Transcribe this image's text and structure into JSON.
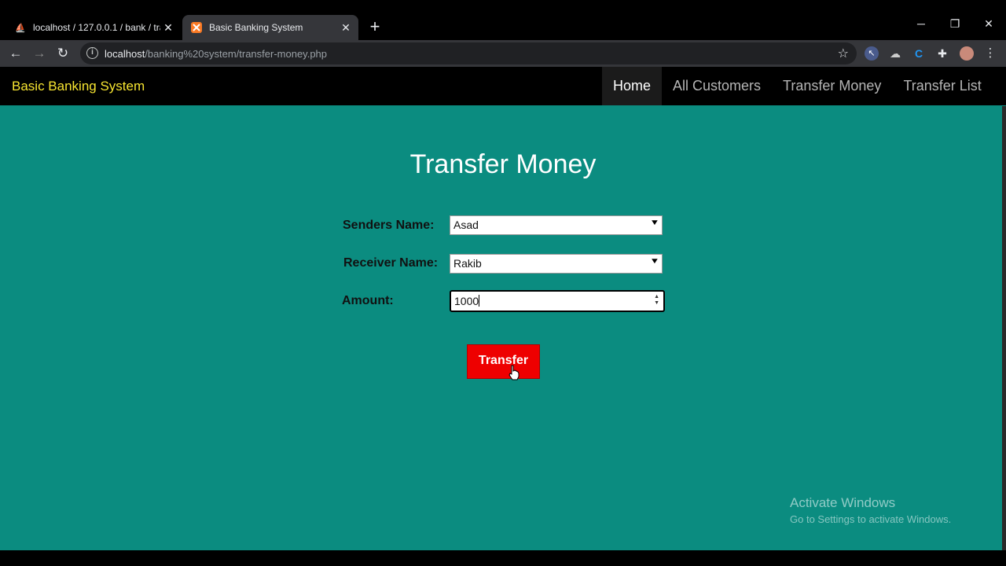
{
  "browser": {
    "tabs": [
      {
        "title": "localhost / 127.0.0.1 / bank / tran",
        "icon": "phpmyadmin-icon"
      },
      {
        "title": "Basic Banking System",
        "icon": "xampp-icon"
      }
    ],
    "new_tab": "+",
    "address": {
      "host": "localhost",
      "path": "/banking%20system/transfer-money.php"
    }
  },
  "navbar": {
    "brand": "Basic Banking System",
    "links": [
      "Home",
      "All Customers",
      "Transfer Money",
      "Transfer List"
    ]
  },
  "form": {
    "heading": "Transfer Money",
    "sender_label": "Senders Name:",
    "sender_value": "Asad",
    "receiver_label": "Receiver Name:",
    "receiver_value": "Rakib",
    "amount_label": "Amount:",
    "amount_value": "1000",
    "submit_label": "Transfer"
  },
  "watermark": {
    "line1": "Activate Windows",
    "line2": "Go to Settings to activate Windows."
  },
  "colors": {
    "page_bg": "#0b8c80",
    "brand": "#f7e531",
    "button": "#ee0000"
  }
}
